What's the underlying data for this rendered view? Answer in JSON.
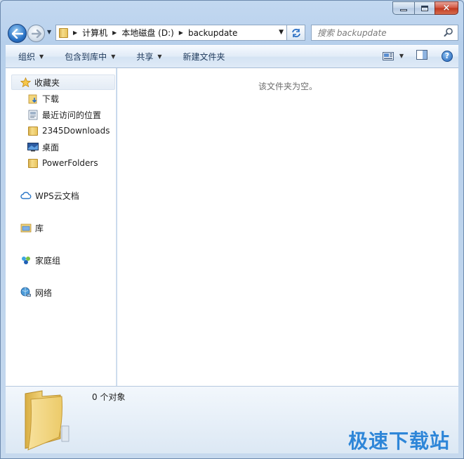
{
  "caption": {
    "minimize": "minimize",
    "maximize": "maximize",
    "close": "×"
  },
  "address": {
    "crumbs": [
      "计算机",
      "本地磁盘 (D:)",
      "backupdate"
    ]
  },
  "search": {
    "placeholder": "搜索 backupdate"
  },
  "toolbar": {
    "organize": "组织",
    "include_in_library": "包含到库中",
    "share": "共享",
    "new_folder": "新建文件夹"
  },
  "nav": {
    "favorites": "收藏夹",
    "favorites_items": [
      "下载",
      "最近访问的位置",
      "2345Downloads",
      "桌面",
      "PowerFolders"
    ],
    "wps_cloud": "WPS云文档",
    "libraries": "库",
    "homegroup": "家庭组",
    "network": "网络"
  },
  "content": {
    "empty_message": "该文件夹为空。"
  },
  "details": {
    "count": "0 个对象"
  },
  "watermark": "极速下载站",
  "colors": {
    "accent": "#2e86d8",
    "window_frame": "#c2d8f0"
  }
}
